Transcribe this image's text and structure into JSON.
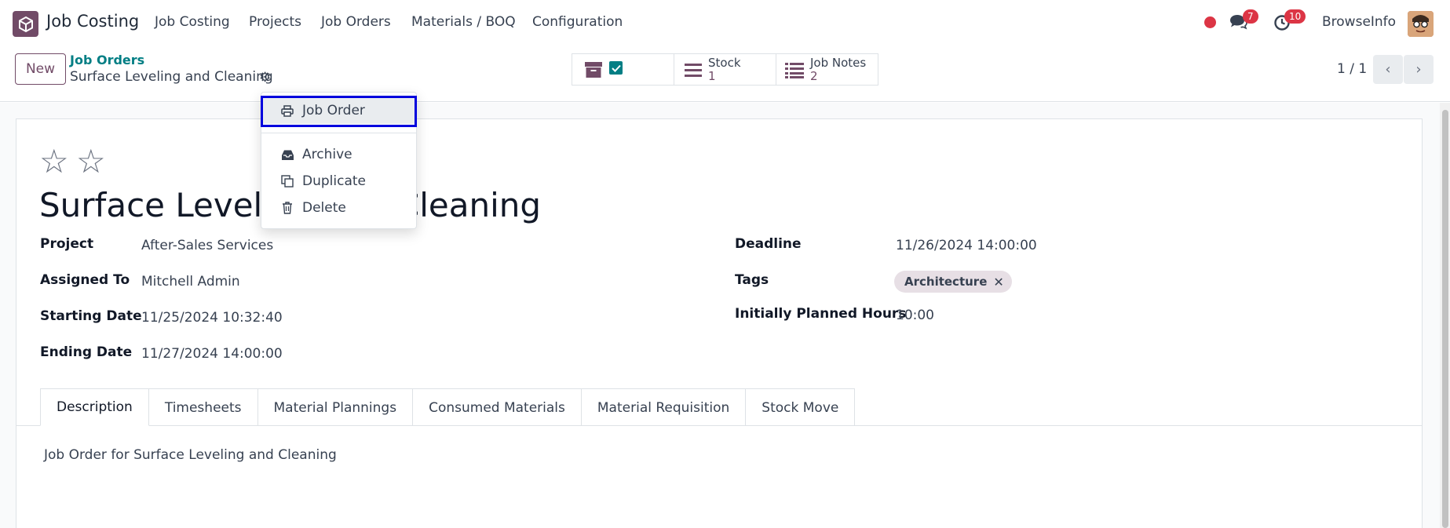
{
  "navbar": {
    "app_name": "Job Costing",
    "menus": [
      "Job Costing",
      "Projects",
      "Job Orders",
      "Materials / BOQ",
      "Configuration"
    ],
    "messages_count": "7",
    "activities_count": "10",
    "user_name": "BrowseInfo"
  },
  "control_panel": {
    "new_label": "New",
    "breadcrumb_parent": "Job Orders",
    "breadcrumb_current": "Surface Leveling and Cleaning",
    "smart_buttons": [
      {
        "label": "Stock",
        "value": "1"
      },
      {
        "label": "Job Notes",
        "value": "2"
      }
    ],
    "pager": "1 / 1"
  },
  "dropdown": {
    "items": [
      "Job Order",
      "Archive",
      "Duplicate",
      "Delete"
    ]
  },
  "record": {
    "title": "Surface Leveling and Cleaning",
    "fields_left": [
      {
        "label": "Project",
        "value": "After-Sales Services"
      },
      {
        "label": "Assigned To",
        "value": "Mitchell Admin"
      },
      {
        "label": "Starting Date",
        "value": "11/25/2024 10:32:40"
      },
      {
        "label": "Ending Date",
        "value": "11/27/2024 14:00:00"
      }
    ],
    "fields_right": [
      {
        "label": "Deadline",
        "value": "11/26/2024 14:00:00"
      },
      {
        "label": "Tags",
        "value": ""
      },
      {
        "label": "Initially Planned Hours",
        "value": "10:00"
      }
    ],
    "tag": "Architecture"
  },
  "tabs": [
    "Description",
    "Timesheets",
    "Material Plannings",
    "Consumed Materials",
    "Material Requisition",
    "Stock Move"
  ],
  "description": "Job Order for Surface Leveling and Cleaning",
  "colors": {
    "brand": "#714b67",
    "link": "#017e84",
    "badge": "#dc3545",
    "highlight": "#0000dd"
  }
}
